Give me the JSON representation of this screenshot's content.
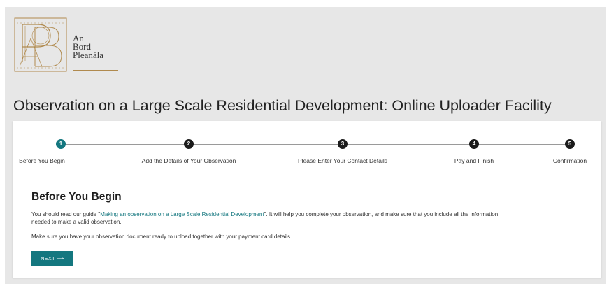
{
  "logo": {
    "line1": "An",
    "line2": "Bord",
    "line3": "Pleanála"
  },
  "page": {
    "title": "Observation on a Large Scale Residential Development: Online Uploader Facility"
  },
  "steps": [
    {
      "number": "1",
      "label": "Before You Begin",
      "active": true
    },
    {
      "number": "2",
      "label": "Add the Details of Your Observation",
      "active": false
    },
    {
      "number": "3",
      "label": "Please Enter Your Contact Details",
      "active": false
    },
    {
      "number": "4",
      "label": "Pay and Finish",
      "active": false
    },
    {
      "number": "5",
      "label": "Confirmation",
      "active": false
    }
  ],
  "section": {
    "title": "Before You Begin",
    "para1_prefix": "You should read our guide \"",
    "para1_link": "Making an observation on a Large Scale Residential Development",
    "para1_suffix": "\". It will help you complete your observation, and make sure that you include all the information",
    "para1_line2": "needed to make a valid observation.",
    "para2": "Make sure you have your observation document ready to upload together with your payment card details."
  },
  "next_button": {
    "label": "NEXT ⟶"
  },
  "colors": {
    "accent": "#14777f",
    "background": "#e7e7e7",
    "logo_gold": "#b08a4e"
  }
}
